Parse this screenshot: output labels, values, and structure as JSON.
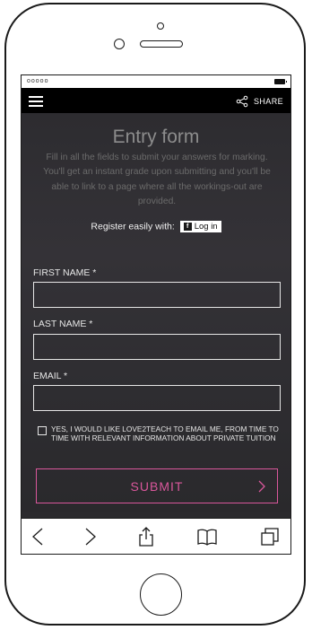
{
  "statusbar": {
    "carrier": "ooooo"
  },
  "navbar": {
    "share_label": "SHARE"
  },
  "form": {
    "title": "Entry form",
    "intro": "Fill in all the fields to submit your answers for marking. You'll get an instant grade upon submitting and you'll be able to link to a page where all the workings-out are provided.",
    "register_text": "Register easily with:",
    "fb_login_label": "Log in",
    "first_name_label": "FIRST NAME *",
    "last_name_label": "LAST NAME *",
    "email_label": "EMAIL *",
    "first_name_value": "",
    "last_name_value": "",
    "email_value": "",
    "consent_text": "YES, I WOULD LIKE LOVE2TEACH TO EMAIL ME, FROM TIME TO TIME WITH RELEVANT INFORMATION ABOUT PRIVATE TUITION",
    "submit_label": "SUBMIT"
  },
  "colors": {
    "accent": "#d9579b",
    "background": "#2b2a2d",
    "navbar": "#000000"
  },
  "icons": [
    "menu-icon",
    "share-icon",
    "facebook-icon",
    "chevron-right-icon",
    "back-icon",
    "forward-icon",
    "share-sheet-icon",
    "bookmarks-icon",
    "tabs-icon"
  ]
}
